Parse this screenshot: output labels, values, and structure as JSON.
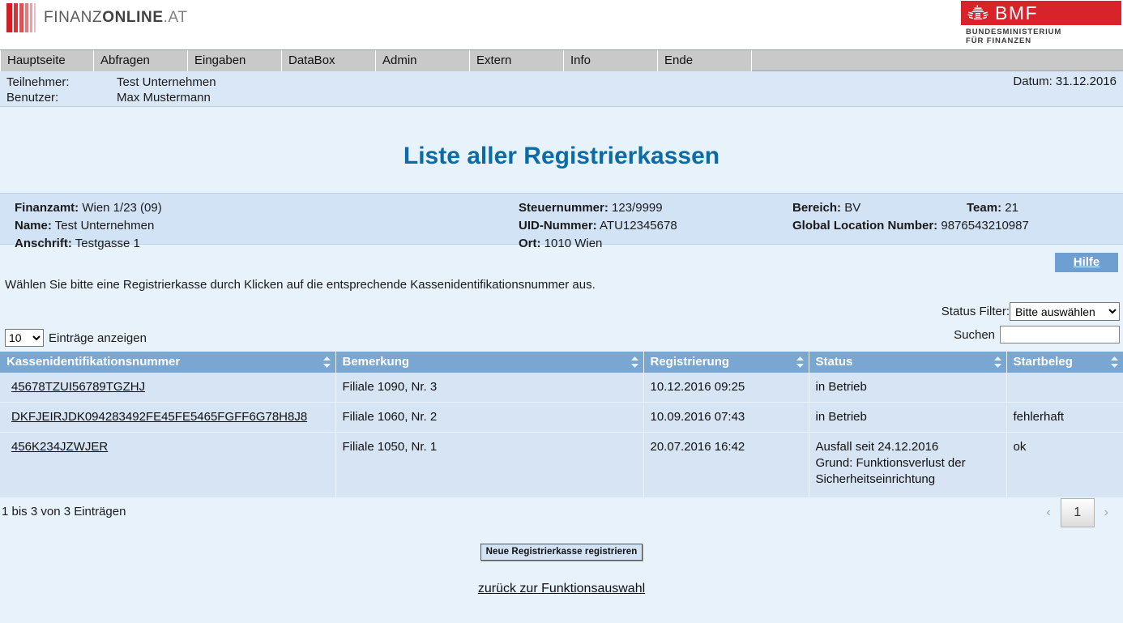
{
  "brand": {
    "finanzonline": {
      "pre": "FINANZ",
      "bold": "ONLINE",
      "suffix": ".AT"
    },
    "bmf": {
      "word": "BMF",
      "subtitle_line1": "BUNDESMINISTERIUM",
      "subtitle_line2": "FÜR FINANZEN"
    },
    "colors": {
      "bmf_red": "#d8232a",
      "title_blue": "#0a6ba6",
      "table_header_blue": "#7aa6d2",
      "row_blue": "#d6e4f4",
      "page_bg": "#e8f2fb"
    }
  },
  "nav": {
    "items": [
      {
        "label": "Hauptseite"
      },
      {
        "label": "Abfragen"
      },
      {
        "label": "Eingaben"
      },
      {
        "label": "DataBox"
      },
      {
        "label": "Admin"
      },
      {
        "label": "Extern"
      },
      {
        "label": "Info"
      },
      {
        "label": "Ende"
      }
    ]
  },
  "userbar": {
    "teilnehmer_label": "Teilnehmer:",
    "teilnehmer_value": "Test Unternehmen",
    "benutzer_label": "Benutzer:",
    "benutzer_value": "Max Mustermann",
    "datum": "Datum: 31.12.2016"
  },
  "page": {
    "title": "Liste aller Registrierkassen",
    "instruction": "Wählen Sie bitte eine Registrierkasse durch Klicken auf die entsprechende Kassenidentifikationsnummer aus.",
    "hilfe_label": "Hilfe"
  },
  "infobox": {
    "finanzamt_label": "Finanzamt:",
    "finanzamt_value": "Wien 1/23  (09)",
    "name_label": "Name:",
    "name_value": "Test Unternehmen",
    "anschrift_label": "Anschrift:",
    "anschrift_value": "Testgasse 1",
    "steuernummer_label": "Steuernummer:",
    "steuernummer_value": "123/9999",
    "uid_label": "UID-Nummer:",
    "uid_value": "ATU12345678",
    "ort_label": "Ort:",
    "ort_value": "1010 Wien",
    "bereich_label": "Bereich:",
    "bereich_value": "BV",
    "gln_label": "Global Location Number:",
    "gln_value": "9876543210987",
    "team_label": "Team:",
    "team_value": "21"
  },
  "controls": {
    "status_filter_label": "Status Filter:",
    "status_filter_value": "Bitte auswählen",
    "status_filter_options": [
      "Bitte auswählen"
    ],
    "search_label": "Suchen",
    "search_value": "",
    "search_placeholder": "",
    "length_value": "10",
    "length_options": [
      "10"
    ],
    "length_label": "Einträge anzeigen"
  },
  "table": {
    "columns": [
      {
        "label": "Kassenidentifikationsnummer"
      },
      {
        "label": "Bemerkung"
      },
      {
        "label": "Registrierung"
      },
      {
        "label": "Status"
      },
      {
        "label": "Startbeleg"
      }
    ],
    "rows": [
      {
        "kassenid": "45678TZUI56789TGZHJ",
        "bemerkung": "Filiale 1090, Nr. 3",
        "registrierung": "10.12.2016 09:25",
        "status": "in Betrieb",
        "startbeleg": ""
      },
      {
        "kassenid": "DKFJEIRJDK094283492FE45FE5465FGFF6G78H8J8",
        "bemerkung": "Filiale 1060, Nr. 2",
        "registrierung": "10.09.2016 07:43",
        "status": "in Betrieb",
        "startbeleg": "fehlerhaft"
      },
      {
        "kassenid": "456K234JZWJER",
        "bemerkung": "Filiale 1050, Nr. 1",
        "registrierung": "20.07.2016 16:42",
        "status": "Ausfall seit 24.12.2016\nGrund: Funktionsverlust der\nSicherheitseinrichtung",
        "startbeleg": "ok"
      }
    ]
  },
  "footer": {
    "info_count": "1 bis 3 von 3 Einträgen",
    "pager": {
      "prev": "‹",
      "current": "1",
      "next": "›"
    },
    "register_button": "Neue Registrierkasse registrieren",
    "back_link": "zurück zur Funktionsauswahl"
  }
}
